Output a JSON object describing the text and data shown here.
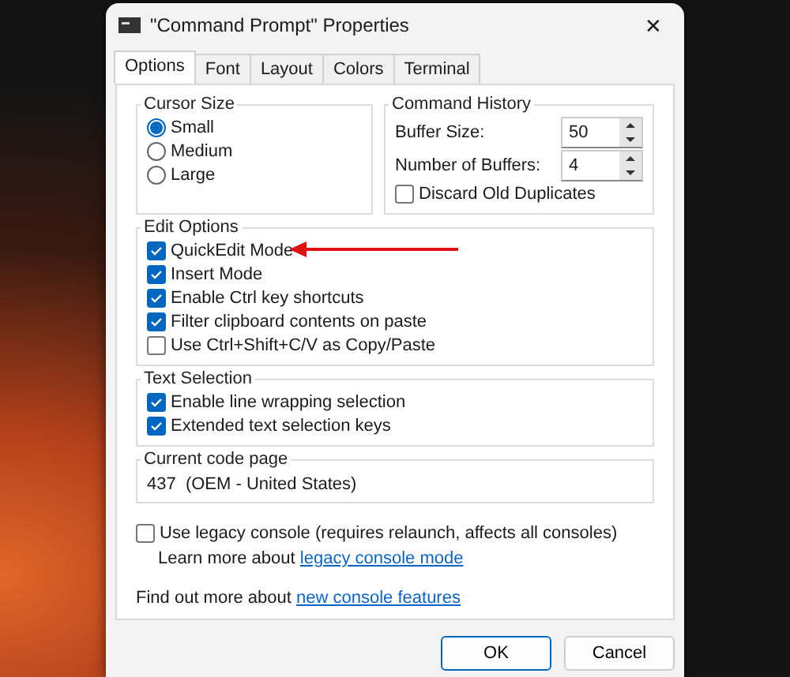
{
  "window": {
    "title": "\"Command Prompt\" Properties",
    "close": "✕"
  },
  "tabs": [
    {
      "label": "Options",
      "selected": true
    },
    {
      "label": "Font",
      "selected": false
    },
    {
      "label": "Layout",
      "selected": false
    },
    {
      "label": "Colors",
      "selected": false
    },
    {
      "label": "Terminal",
      "selected": false
    }
  ],
  "cursor_size": {
    "title": "Cursor Size",
    "options": [
      {
        "label": "Small",
        "selected": true
      },
      {
        "label": "Medium",
        "selected": false
      },
      {
        "label": "Large",
        "selected": false
      }
    ]
  },
  "command_history": {
    "title": "Command History",
    "spinners": [
      {
        "label": "Buffer Size:",
        "value": "50"
      },
      {
        "label": "Number of Buffers:",
        "value": "4"
      }
    ],
    "discard": {
      "label": "Discard Old Duplicates",
      "checked": false
    }
  },
  "edit_options": {
    "title": "Edit Options",
    "items": [
      {
        "label": "QuickEdit Mode",
        "checked": true
      },
      {
        "label": "Insert Mode",
        "checked": true
      },
      {
        "label": "Enable Ctrl key shortcuts",
        "checked": true
      },
      {
        "label": "Filter clipboard contents on paste",
        "checked": true
      },
      {
        "label": "Use Ctrl+Shift+C/V as Copy/Paste",
        "checked": false
      }
    ]
  },
  "text_selection": {
    "title": "Text Selection",
    "items": [
      {
        "label": "Enable line wrapping selection",
        "checked": true
      },
      {
        "label": "Extended text selection keys",
        "checked": true
      }
    ]
  },
  "code_page": {
    "title": "Current code page",
    "value": "437  (OEM - United States)"
  },
  "legacy": {
    "label": "Use legacy console (requires relaunch, affects all consoles)",
    "checked": false
  },
  "learn_more": {
    "text": "Learn more about ",
    "link": "legacy console mode"
  },
  "find_out": {
    "text": "Find out more about ",
    "link": "new console features"
  },
  "buttons": [
    {
      "label": "OK",
      "default": true
    },
    {
      "label": "Cancel",
      "default": false
    }
  ]
}
